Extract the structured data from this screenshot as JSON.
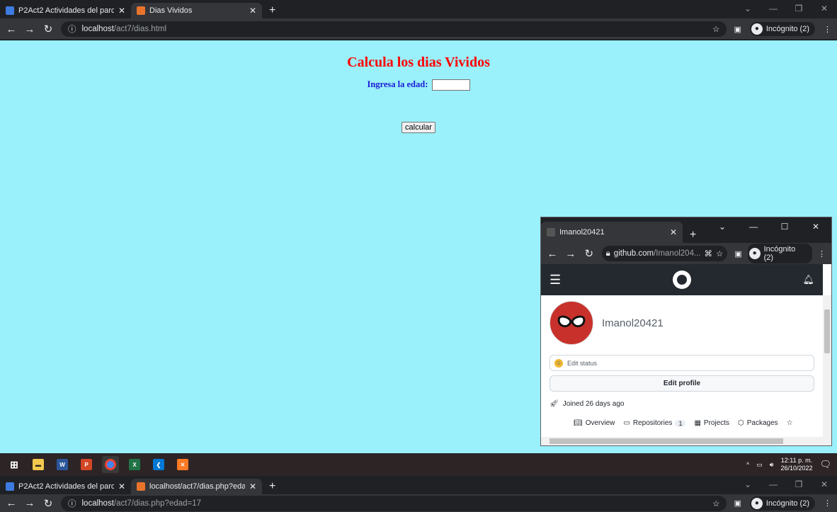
{
  "main_window": {
    "tabs": [
      {
        "title": "P2Act2 Actividades del parcial 7...",
        "favicon_color": "#3d7be0"
      },
      {
        "title": "Dias Vividos",
        "favicon_color": "#e8742c"
      }
    ],
    "url_host": "localhost",
    "url_path": "/act7/dias.html",
    "incognito_label": "Incógnito (2)"
  },
  "page": {
    "heading": "Calcula los dias Vividos",
    "age_label": "Ingresa la edad:",
    "age_value": "",
    "button_label": "calcular",
    "bg_color": "#9af0fb"
  },
  "popup_window": {
    "tab_title": "Imanol20421",
    "url_host": "github.com",
    "url_path": "/Imanol204...",
    "incognito_label": "Incógnito (2)",
    "username": "Imanol20421",
    "edit_status": "Edit status",
    "edit_profile": "Edit profile",
    "joined": "Joined 26 days ago",
    "nav": {
      "overview": "Overview",
      "repositories": "Repositories",
      "repositories_count": "1",
      "projects": "Projects",
      "packages": "Packages"
    }
  },
  "taskbar": {
    "time": "12:11 p. m.",
    "date": "26/10/2022",
    "icons": [
      "windows-start-icon",
      "file-explorer-icon",
      "word-icon",
      "powerpoint-icon",
      "chrome-icon",
      "excel-icon",
      "vscode-icon",
      "xampp-icon"
    ]
  },
  "bottom_window": {
    "tabs": [
      {
        "title": "P2Act2 Actividades del parcial 7...",
        "favicon_color": "#3d7be0"
      },
      {
        "title": "localhost/act7/dias.php?edad=1...",
        "favicon_color": "#e8742c"
      }
    ],
    "url_host": "localhost",
    "url_path": "/act7/dias.php?edad=17",
    "incognito_label": "Incógnito (2)"
  }
}
